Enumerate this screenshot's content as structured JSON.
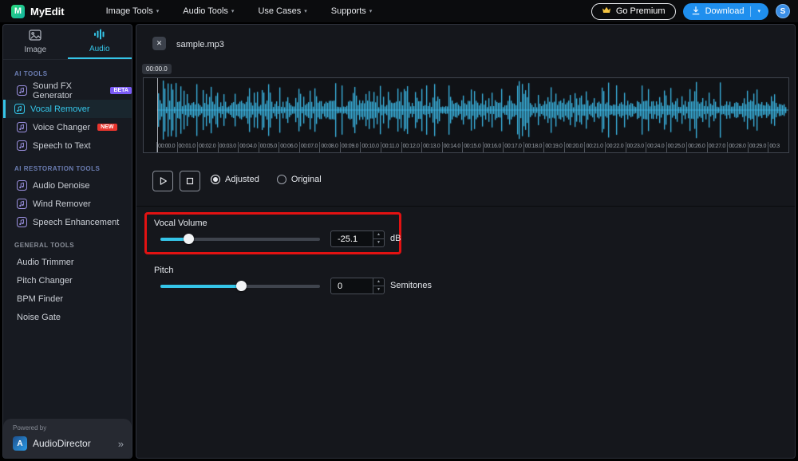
{
  "colors": {
    "accent": "#35c5e8",
    "download_blue": "#1f8fee",
    "highlight_red": "#e21212",
    "badge_beta": "#7a5af5",
    "badge_new": "#e8352e"
  },
  "topbar": {
    "brand": "MyEdit",
    "brand_initial": "M",
    "nav": [
      {
        "label": "Image Tools"
      },
      {
        "label": "Audio Tools"
      },
      {
        "label": "Use Cases"
      },
      {
        "label": "Supports"
      }
    ],
    "premium_label": "Go Premium",
    "download_label": "Download",
    "avatar_initial": "S"
  },
  "sidebar": {
    "tabs": [
      {
        "label": "Image",
        "active": false
      },
      {
        "label": "Audio",
        "active": true
      }
    ],
    "sections": [
      {
        "title": "AI TOOLS",
        "title_color": "#6b7db3",
        "icons": true,
        "items": [
          {
            "label": "Sound FX Generator",
            "badge": "BETA",
            "badge_bg": "#7a5af5"
          },
          {
            "label": "Vocal Remover",
            "active": true
          },
          {
            "label": "Voice Changer",
            "badge": "NEW",
            "badge_bg": "#e8352e"
          },
          {
            "label": "Speech to Text"
          }
        ]
      },
      {
        "title": "AI RESTORATION TOOLS",
        "title_color": "#6b7db3",
        "icons": true,
        "items": [
          {
            "label": "Audio Denoise"
          },
          {
            "label": "Wind Remover"
          },
          {
            "label": "Speech Enhancement"
          }
        ]
      },
      {
        "title": "GENERAL TOOLS",
        "title_color": "#8a8f99",
        "icons": false,
        "items": [
          {
            "label": "Audio Trimmer"
          },
          {
            "label": "Pitch Changer"
          },
          {
            "label": "BPM Finder"
          },
          {
            "label": "Noise Gate"
          }
        ]
      }
    ],
    "footer": {
      "powered_by": "Powered by",
      "brand": "AudioDirector",
      "more": "»"
    }
  },
  "main": {
    "filename": "sample.mp3",
    "close_label": "✕",
    "playhead_time": "00:00.0",
    "timeline": [
      "00:00.0",
      "00:01.0",
      "00:02.0",
      "00:03.0",
      "00:04.0",
      "00:05.0",
      "00:06.0",
      "00:07.0",
      "00:08.0",
      "00:09.0",
      "00:10.0",
      "00:11.0",
      "00:12.0",
      "00:13.0",
      "00:14.0",
      "00:15.0",
      "00:16.0",
      "00:17.0",
      "00:18.0",
      "00:19.0",
      "00:20.0",
      "00:21.0",
      "00:22.0",
      "00:23.0",
      "00:24.0",
      "00:25.0",
      "00:26.0",
      "00:27.0",
      "00:28.0",
      "00:29.0",
      "00:3"
    ],
    "radios": [
      {
        "label": "Adjusted",
        "selected": true
      },
      {
        "label": "Original",
        "selected": false
      }
    ],
    "controls": {
      "vocal_volume": {
        "label": "Vocal Volume",
        "value": "-25.1",
        "unit": "dB",
        "slider_pct": 17.5
      },
      "pitch": {
        "label": "Pitch",
        "value": "0",
        "unit": "Semitones",
        "slider_pct": 50.5
      }
    }
  }
}
